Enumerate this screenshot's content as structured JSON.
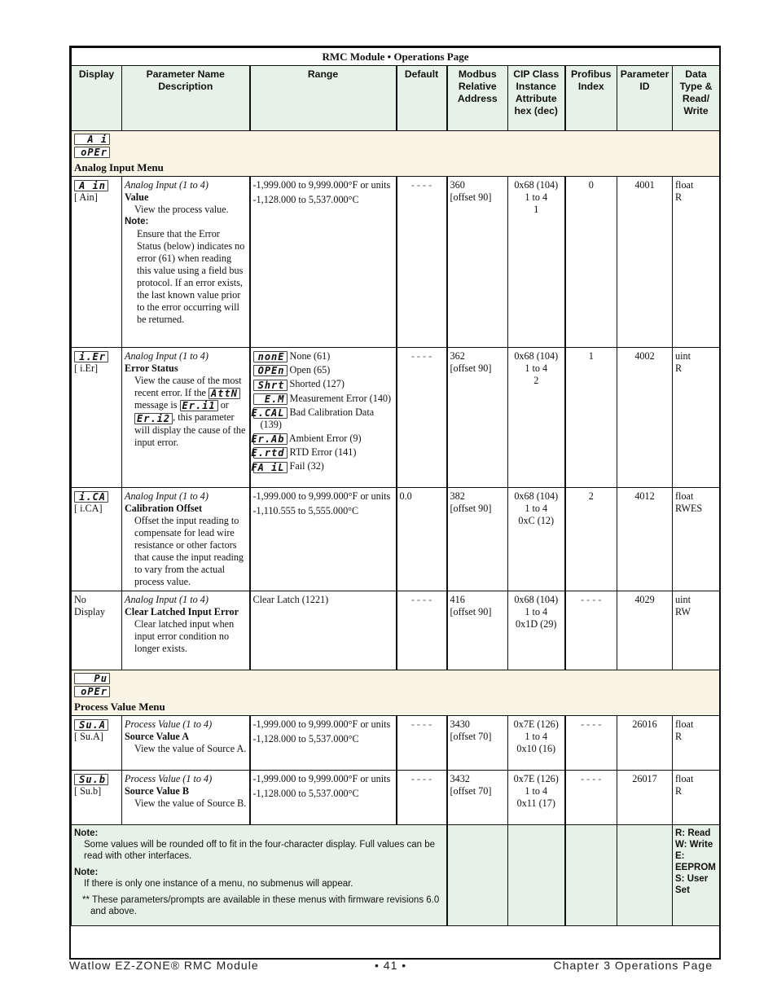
{
  "title": "RMC Module  •  Operations Page",
  "headers": {
    "display": "Display",
    "param": "Parameter Name Description",
    "range": "Range",
    "default": "Default",
    "modbus": "Modbus Relative Address",
    "cip": "CIP Class Instance Attribute hex (dec)",
    "profibus": "Profibus Index",
    "param_id": "Parameter ID",
    "data_type": "Data Type & Read/ Write"
  },
  "menus": [
    {
      "lcd_top": "A i",
      "lcd_bottom": "oPEr",
      "title": "Analog Input Menu",
      "rows": [
        {
          "lcd": "A in",
          "code": "[ Ain]",
          "context": "Analog Input (1 to 4)",
          "name": "Value",
          "desc": "View the process value.",
          "note_label": "Note:",
          "note": "Ensure that the Error Status (below) indicates no error (61) when reading this value using a field bus protocol. If an error exists, the last known value prior to the error occurring will be returned.",
          "range": [
            "-1,999.000 to 9,999.000°F or units",
            "-1,128.000 to 5,537.000°C"
          ],
          "default": "- - - -",
          "modbus": [
            "360",
            "[offset 90]"
          ],
          "cip": [
            "0x68 (104)",
            "1 to 4",
            "1"
          ],
          "profibus": "0",
          "param_id": "4001",
          "data_type": [
            "float",
            "R"
          ]
        },
        {
          "lcd": "i.Er",
          "code": "[ i.Er]",
          "context": "Analog Input (1 to 4)",
          "name": "Error Status",
          "desc_parts": [
            "View the cause of the most recent error. If the",
            "AttN",
            "message is",
            "Er.i1",
            "or",
            "Er.i2",
            ", this parameter will display the cause of the input error."
          ],
          "options": [
            {
              "lcd": "nonE",
              "label": "None (61)"
            },
            {
              "lcd": "OPEn",
              "label": "Open (65)"
            },
            {
              "lcd": "Shrt",
              "label": "Shorted (127)"
            },
            {
              "lcd": "E.M",
              "label": "Measurement Error (140)"
            },
            {
              "lcd": "E.CAL",
              "label": "Bad Calibration Data (139)"
            },
            {
              "lcd": "Er.Ab",
              "label": "Ambient Error (9)"
            },
            {
              "lcd": "E.rtd",
              "label": "RTD Error (141)"
            },
            {
              "lcd": "FA iL",
              "label": "Fail (32)"
            }
          ],
          "default": "- - - -",
          "modbus": [
            "362",
            "[offset 90]"
          ],
          "cip": [
            "0x68 (104)",
            "1 to 4",
            "2"
          ],
          "profibus": "1",
          "param_id": "4002",
          "data_type": [
            "uint",
            "R"
          ]
        },
        {
          "lcd": "i.CA",
          "code": "[ i.CA]",
          "context": "Analog Input (1 to 4)",
          "name": "Calibration Offset",
          "desc": "Offset the input reading to compensate for lead wire resistance or other factors that cause the input reading to vary from the actual process value.",
          "range": [
            "-1,999.000 to 9,999.000°F or units",
            "-1,110.555 to 5,555.000°C"
          ],
          "default": "0.0",
          "modbus": [
            "382",
            "[offset 90]"
          ],
          "cip": [
            "0x68 (104)",
            "1 to 4",
            "0xC (12)"
          ],
          "profibus": "2",
          "param_id": "4012",
          "data_type": [
            "float",
            "RWES"
          ]
        },
        {
          "code": "No Display",
          "context": "Analog Input (1 to 4)",
          "name": "Clear Latched Input Error",
          "desc": "Clear latched input when input error condition no longer exists.",
          "range": [
            "Clear Latch (1221)"
          ],
          "default": "- - - -",
          "modbus": [
            "416",
            "[offset 90]"
          ],
          "cip": [
            "0x68 (104)",
            "1 to 4",
            "0x1D (29)"
          ],
          "profibus": "- - - -",
          "param_id": "4029",
          "data_type": [
            "uint",
            "RW"
          ]
        }
      ]
    },
    {
      "lcd_top": "Pu",
      "lcd_bottom": "oPEr",
      "title": "Process Value Menu",
      "rows": [
        {
          "lcd": "Su.A",
          "code": "[ Su.A]",
          "context": "Process Value (1 to 4)",
          "name": "Source Value A",
          "desc": "View the value of Source A.",
          "range": [
            "-1,999.000 to 9,999.000°F or units",
            "-1,128.000 to 5,537.000°C"
          ],
          "default": "- - - -",
          "modbus": [
            "3430",
            "[offset 70]"
          ],
          "cip": [
            "0x7E (126)",
            "1 to 4",
            "0x10 (16)"
          ],
          "profibus": "- - - -",
          "param_id": "26016",
          "data_type": [
            "float",
            "R"
          ]
        },
        {
          "lcd": "Su.b",
          "code": "[ Su.b]",
          "context": "Process Value (1 to 4)",
          "name": "Source Value B",
          "desc": "View the value of Source B.",
          "range": [
            "-1,999.000 to 9,999.000°F or units",
            "-1,128.000 to 5,537.000°C"
          ],
          "default": "- - - -",
          "modbus": [
            "3432",
            "[offset 70]"
          ],
          "cip": [
            "0x7E (126)",
            "1 to 4",
            "0x11 (17)"
          ],
          "profibus": "- - - -",
          "param_id": "26017",
          "data_type": [
            "float",
            "R"
          ]
        }
      ]
    }
  ],
  "footnotes": {
    "note1_label": "Note:",
    "note1": "Some values will be rounded off to fit in the four-character display. Full values can be read with other interfaces.",
    "note2_label": "Note:",
    "note2": "If there is only one instance of a menu, no submenus will appear.",
    "star_note": "** These parameters/prompts are available in these menus with firmware revisions 6.0 and above.",
    "legend": [
      "R: Read",
      "W: Write",
      "E: EEPROM",
      "S: User Set"
    ]
  },
  "page_footer": {
    "left": "Watlow EZ-ZONE® RMC Module",
    "center": "•  41  •",
    "right": "Chapter 3 Operations Page"
  }
}
